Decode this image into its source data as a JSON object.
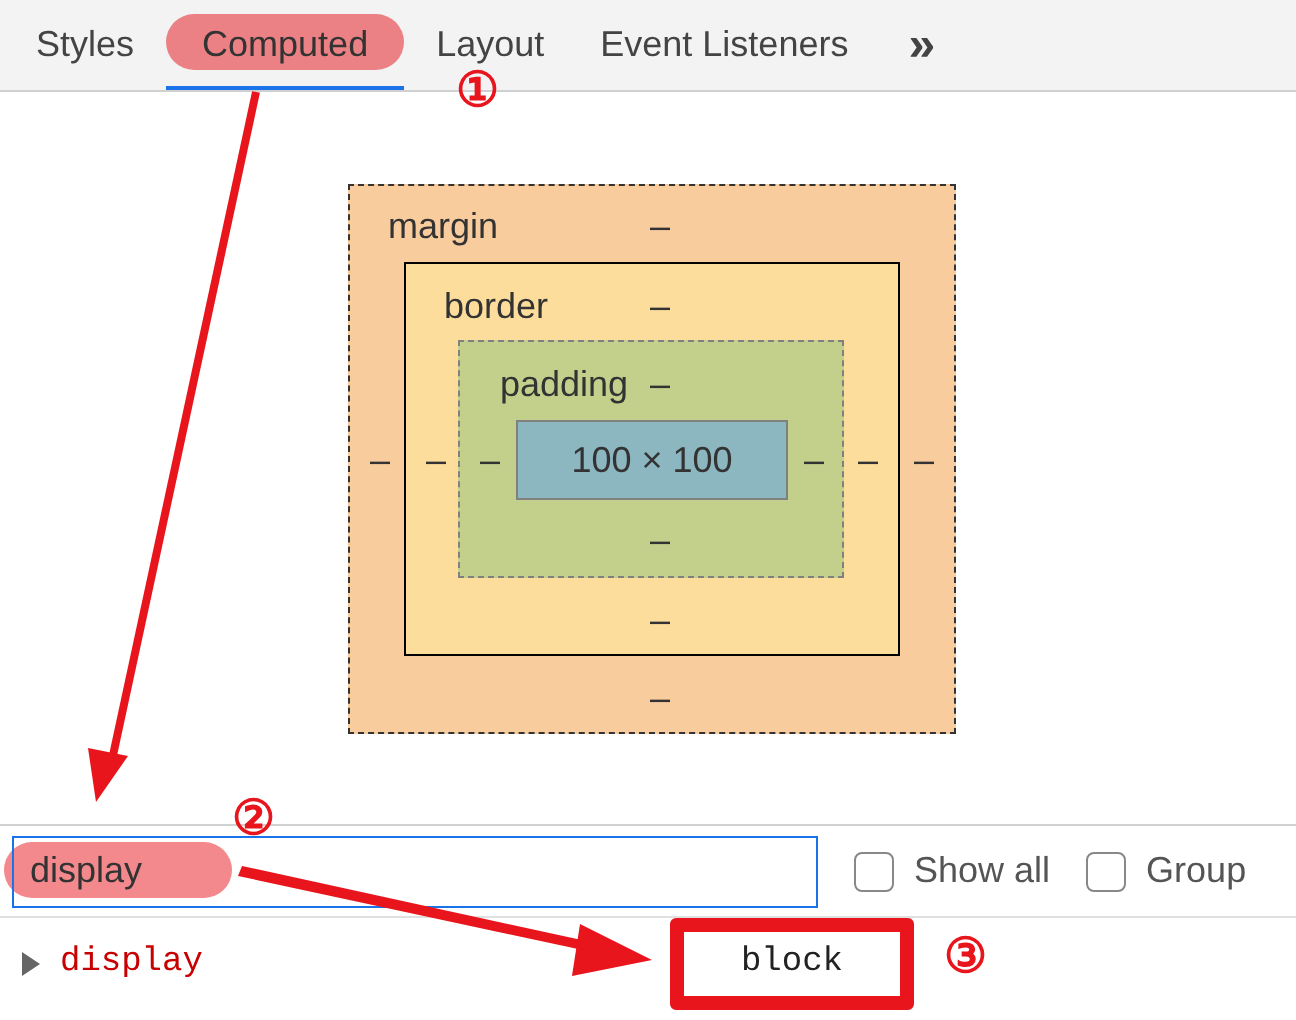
{
  "tabs": [
    {
      "label": "Styles",
      "selected": false
    },
    {
      "label": "Computed",
      "selected": true
    },
    {
      "label": "Layout",
      "selected": false
    },
    {
      "label": "Event Listeners",
      "selected": false
    }
  ],
  "more_tabs": "»",
  "box_model": {
    "margin": {
      "label": "margin",
      "top": "–",
      "right": "–",
      "bottom": "–",
      "left": "–"
    },
    "border": {
      "label": "border",
      "top": "–",
      "right": "–",
      "bottom": "–",
      "left": "–"
    },
    "padding": {
      "label": "padding",
      "top": "–",
      "right": "–",
      "bottom": "–",
      "left": "–"
    },
    "content": "100 × 100"
  },
  "filter": {
    "value": "display"
  },
  "checkboxes": [
    {
      "label": "Show all",
      "checked": false
    },
    {
      "label": "Group",
      "checked": false
    }
  ],
  "properties": [
    {
      "name": "display",
      "value": "block",
      "expanded": false
    }
  ],
  "annotations": [
    {
      "kind": "number",
      "text": "①"
    },
    {
      "kind": "number",
      "text": "②"
    },
    {
      "kind": "number",
      "text": "③"
    }
  ]
}
